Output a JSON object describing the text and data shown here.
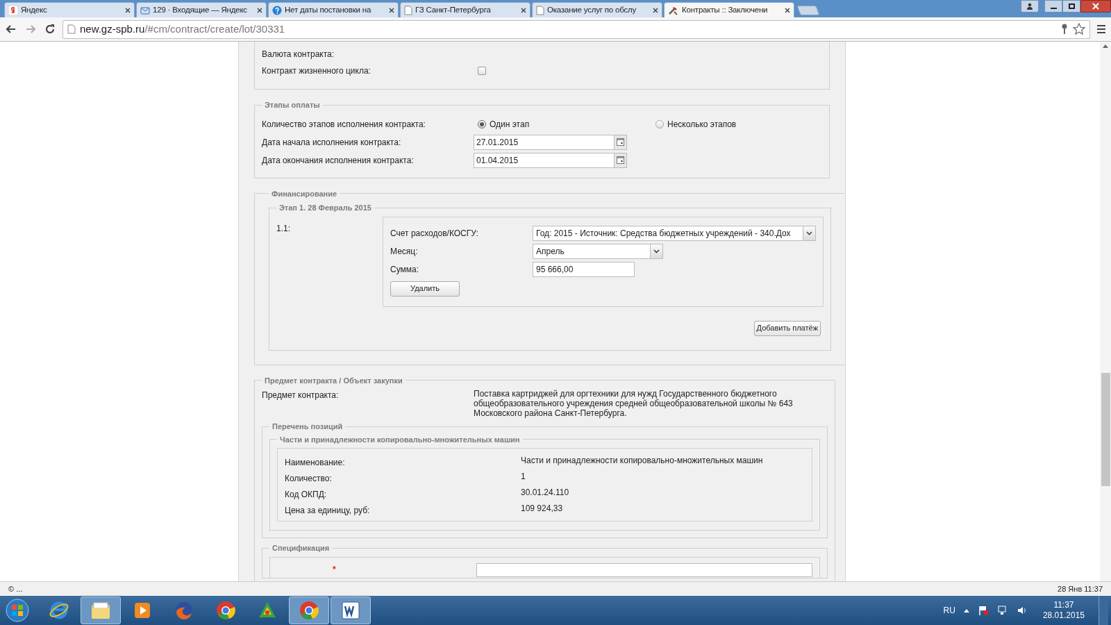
{
  "browser": {
    "tabs": [
      {
        "title": "Яндекс",
        "kind": "yandex",
        "selected": false
      },
      {
        "title": "129 · Входящие — Яндекс",
        "kind": "mail",
        "selected": false
      },
      {
        "title": "Нет даты постановки на",
        "kind": "help",
        "selected": false
      },
      {
        "title": "ГЗ Санкт-Петербурга",
        "kind": "page",
        "selected": false
      },
      {
        "title": "Оказание услуг по обслу",
        "kind": "page",
        "selected": false
      },
      {
        "title": "Контракты :: Заключени",
        "kind": "tools",
        "selected": true
      }
    ],
    "address": {
      "host": "new.gz-spb.ru",
      "path": "/#cm/contract/create/lot/30331"
    }
  },
  "form": {
    "general": {
      "rows": [
        {
          "kind": "text",
          "label": "Валюта контракта:"
        },
        {
          "kind": "checkbox",
          "label": "Контракт жизненного цикла:",
          "checked": false
        }
      ]
    },
    "payment_stages": {
      "legend": "Этапы оплаты",
      "count_label": "Количество этапов исполнения контракта:",
      "options": [
        {
          "label": "Один этап",
          "selected": true
        },
        {
          "label": "Несколько этапов",
          "selected": false
        }
      ],
      "date_fields": [
        {
          "label": "Дата начала исполнения контракта:",
          "value": "27.01.2015"
        },
        {
          "label": "Дата окончания исполнения контракта:",
          "value": "01.04.2015"
        }
      ]
    },
    "financing": {
      "legend": "Финансирование",
      "stage": {
        "legend": "Этап 1. 28 Февраль 2015",
        "number": "1.1:",
        "fields": [
          {
            "kind": "select",
            "label": "Счет расходов/КОСГУ:",
            "value": "Год: 2015 - Источник: Средства бюджетных учреждений - 340.Дох"
          },
          {
            "kind": "select_short",
            "label": "Месяц:",
            "value": "Апрель"
          },
          {
            "kind": "input",
            "label": "Сумма:",
            "value": "95 666,00"
          }
        ],
        "delete_button": "Удалить"
      },
      "add_button": "Добавить платёж"
    },
    "subject": {
      "legend": "Предмет контракта / Объект закупки",
      "subject_label": "Предмет контракта:",
      "subject_text": "Поставка картриджей для оргтехники для нужд Государственного бюджетного общеобразовательного учреждения средней общеобразовательной школы № 643 Московского района Санкт-Петербурга.",
      "positions": {
        "legend": "Перечень позиций",
        "group": {
          "legend": "Части и принадлежности копировально-множительных машин",
          "rows": [
            {
              "label": "Наименование:",
              "value": "Части и принадлежности копировально-множительных машин"
            },
            {
              "label": "Количество:",
              "value": "1"
            },
            {
              "label": "Код ОКПД:",
              "value": "30.01.24.110"
            },
            {
              "label": "Цена за единицу, руб:",
              "value": "109 924,33"
            }
          ]
        }
      },
      "specification": {
        "legend": "Спецификация",
        "required_mark": "*"
      }
    }
  },
  "status_bar": {
    "left": "© ...",
    "right": "28 Янв 11:37"
  },
  "taskbar": {
    "apps": [
      {
        "kind": "ie",
        "active": false
      },
      {
        "kind": "explorer",
        "active": true
      },
      {
        "kind": "media",
        "active": false
      },
      {
        "kind": "firefox",
        "active": false
      },
      {
        "kind": "chrome",
        "active": false
      },
      {
        "kind": "green",
        "active": false
      },
      {
        "kind": "chrome",
        "active": true
      },
      {
        "kind": "word",
        "active": true
      }
    ],
    "language": "RU",
    "time": "11:37",
    "date": "28.01.2015"
  }
}
